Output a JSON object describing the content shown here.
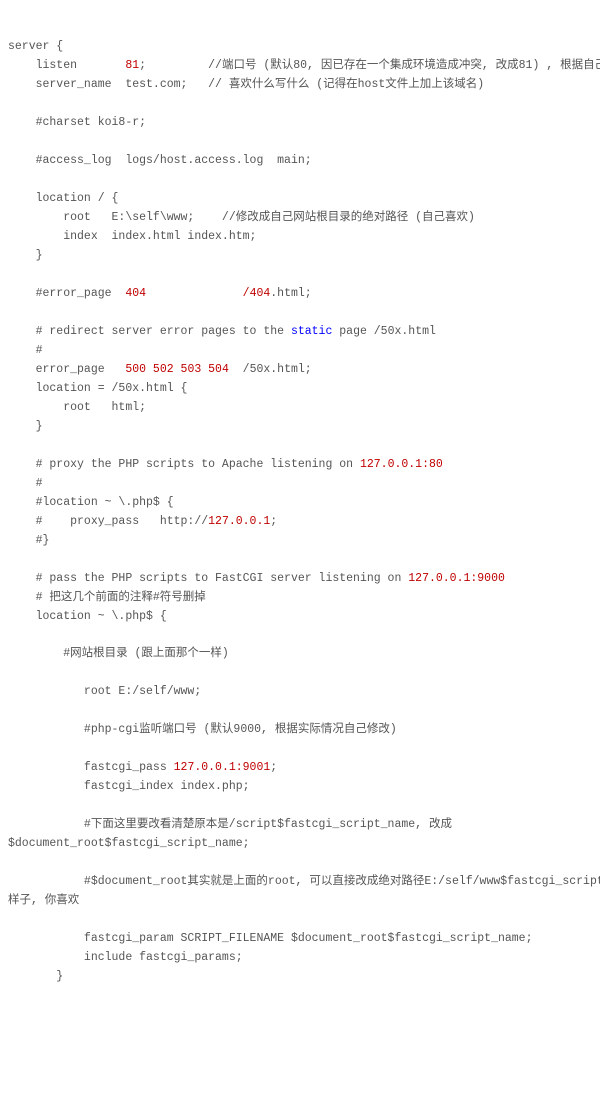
{
  "config": {
    "lines": [
      {
        "segs": [
          {
            "t": "server {"
          }
        ]
      },
      {
        "segs": [
          {
            "t": "    listen       "
          },
          {
            "t": "81",
            "cls": "num"
          },
          {
            "t": ";         //端口号 (默认80, 因已存在一个集成环境造成冲突, 改成81) , 根据自己需要修改"
          }
        ]
      },
      {
        "segs": [
          {
            "t": "    server_name  test.com;   // 喜欢什么写什么 (记得在host文件上加上该域名)"
          }
        ]
      },
      {
        "segs": [
          {
            "t": ""
          }
        ]
      },
      {
        "segs": [
          {
            "t": "    #charset koi8-r;"
          }
        ]
      },
      {
        "segs": [
          {
            "t": ""
          }
        ]
      },
      {
        "segs": [
          {
            "t": "    #access_log  logs/host.access.log  main;"
          }
        ]
      },
      {
        "segs": [
          {
            "t": ""
          }
        ]
      },
      {
        "segs": [
          {
            "t": "    location / {"
          }
        ]
      },
      {
        "segs": [
          {
            "t": "        root   E:\\self\\www;    //修改成自己网站根目录的绝对路径 (自己喜欢)"
          }
        ]
      },
      {
        "segs": [
          {
            "t": "        index  index.html index.htm;"
          }
        ]
      },
      {
        "segs": [
          {
            "t": "    }"
          }
        ]
      },
      {
        "segs": [
          {
            "t": ""
          }
        ]
      },
      {
        "segs": [
          {
            "t": "    #error_page  "
          },
          {
            "t": "404",
            "cls": "num"
          },
          {
            "t": "              "
          },
          {
            "t": "/404",
            "cls": "file"
          },
          {
            "t": ".html;"
          }
        ]
      },
      {
        "segs": [
          {
            "t": ""
          }
        ]
      },
      {
        "segs": [
          {
            "t": "    # redirect server error pages to the "
          },
          {
            "t": "static",
            "cls": "kw"
          },
          {
            "t": " page /50x.html"
          }
        ]
      },
      {
        "segs": [
          {
            "t": "    #"
          }
        ]
      },
      {
        "segs": [
          {
            "t": "    error_page   "
          },
          {
            "t": "500 502 503 504",
            "cls": "num"
          },
          {
            "t": "  /50x.html;"
          }
        ]
      },
      {
        "segs": [
          {
            "t": "    location = /50x.html {"
          }
        ]
      },
      {
        "segs": [
          {
            "t": "        root   html;"
          }
        ]
      },
      {
        "segs": [
          {
            "t": "    }"
          }
        ]
      },
      {
        "segs": [
          {
            "t": ""
          }
        ]
      },
      {
        "segs": [
          {
            "t": "    # proxy the PHP scripts to Apache listening on "
          },
          {
            "t": "127.0.0.1:80",
            "cls": "ip"
          }
        ]
      },
      {
        "segs": [
          {
            "t": "    #"
          }
        ]
      },
      {
        "segs": [
          {
            "t": "    #location ~ \\.php$ {"
          }
        ]
      },
      {
        "segs": [
          {
            "t": "    #    proxy_pass   http://"
          },
          {
            "t": "127.0.0.1",
            "cls": "ip"
          },
          {
            "t": ";"
          }
        ]
      },
      {
        "segs": [
          {
            "t": "    #}"
          }
        ]
      },
      {
        "segs": [
          {
            "t": ""
          }
        ]
      },
      {
        "segs": [
          {
            "t": "    # pass the PHP scripts to FastCGI server listening on "
          },
          {
            "t": "127.0.0.1:9000",
            "cls": "ip"
          }
        ]
      },
      {
        "segs": [
          {
            "t": "    # 把这几个前面的注释#符号删掉"
          }
        ]
      },
      {
        "segs": [
          {
            "t": "    location ~ \\.php$ {"
          }
        ]
      },
      {
        "segs": [
          {
            "t": ""
          }
        ]
      },
      {
        "segs": [
          {
            "t": "        #网站根目录 (跟上面那个一样)"
          }
        ]
      },
      {
        "segs": [
          {
            "t": ""
          }
        ]
      },
      {
        "segs": [
          {
            "t": "           root E:/self/www;"
          }
        ]
      },
      {
        "segs": [
          {
            "t": ""
          }
        ]
      },
      {
        "segs": [
          {
            "t": "           #php-cgi监听端口号 (默认9000, 根据实际情况自己修改)"
          }
        ]
      },
      {
        "segs": [
          {
            "t": ""
          }
        ]
      },
      {
        "segs": [
          {
            "t": "           fastcgi_pass "
          },
          {
            "t": "127.0.0.1:9001",
            "cls": "ip"
          },
          {
            "t": ";"
          }
        ]
      },
      {
        "segs": [
          {
            "t": "           fastcgi_index index.php;"
          }
        ]
      },
      {
        "segs": [
          {
            "t": ""
          }
        ]
      },
      {
        "segs": [
          {
            "t": "           #下面这里要改看清楚原本是/script$fastcgi_script_name, 改成"
          }
        ]
      },
      {
        "segs": [
          {
            "t": "$document_root$fastcgi_script_name;"
          }
        ]
      },
      {
        "segs": [
          {
            "t": ""
          }
        ]
      },
      {
        "segs": [
          {
            "t": "           #$document_root其实就是上面的root, 可以直接改成绝对路径E:/self/www$fastcgi_script_name这"
          }
        ]
      },
      {
        "segs": [
          {
            "t": "样子, 你喜欢"
          }
        ]
      },
      {
        "segs": [
          {
            "t": ""
          }
        ]
      },
      {
        "segs": [
          {
            "t": "           fastcgi_param SCRIPT_FILENAME $document_root$fastcgi_script_name;"
          }
        ]
      },
      {
        "segs": [
          {
            "t": "           include fastcgi_params;"
          }
        ]
      },
      {
        "segs": [
          {
            "t": "       }"
          }
        ]
      }
    ]
  }
}
